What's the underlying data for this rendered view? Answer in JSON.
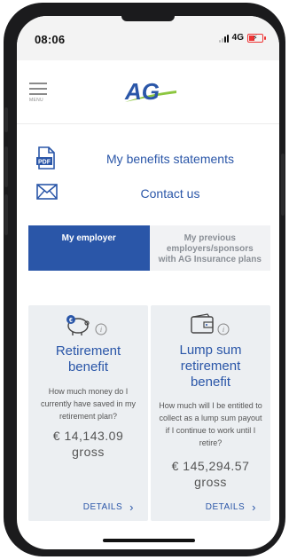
{
  "status_bar": {
    "time": "08:06",
    "network": "4G"
  },
  "header": {
    "menu_label": "MENU",
    "logo_text": "AG"
  },
  "links": {
    "benefits_statements": "My benefits statements",
    "contact_us": "Contact us",
    "pdf_icon_text": "PDF"
  },
  "tabs": [
    {
      "label": "My employer",
      "active": true
    },
    {
      "label": "My previous employers/sponsors with AG Insurance plans",
      "active": false
    }
  ],
  "cards": [
    {
      "title": "Retirement benefit",
      "description": "How much money do I currently have saved in my retirement plan?",
      "amount": "€ 14,143.09",
      "amount_note": "gross",
      "action": "DETAILS",
      "icon": "piggy-bank-icon"
    },
    {
      "title": "Lump sum retirement benefit",
      "description": "How much will I be entitled to collect as a lump sum payout if I continue to work until I retire?",
      "amount": "€ 145,294.57",
      "amount_note": "gross",
      "action": "DETAILS",
      "icon": "wallet-icon"
    }
  ],
  "colors": {
    "brand_blue": "#2a56a8",
    "brand_green": "#8cc63f",
    "card_bg": "#eceff2",
    "tab_inactive_bg": "#f1f2f4"
  }
}
